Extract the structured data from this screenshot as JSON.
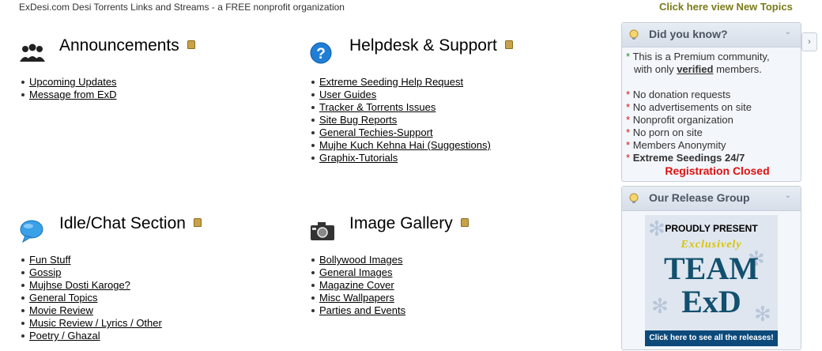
{
  "header": {
    "tagline": "ExDesi.com Desi Torrents Links and Streams - a FREE nonprofit organization",
    "new_topics": "Click here view New Topics"
  },
  "forums": [
    {
      "title": "Announcements",
      "icon": "users-icon",
      "links": [
        "Upcoming Updates",
        "Message from ExD"
      ]
    },
    {
      "title": "Helpdesk & Support",
      "icon": "help-icon",
      "links": [
        "Extreme Seeding Help Request",
        "User Guides",
        "Tracker & Torrents Issues",
        "Site Bug Reports",
        "General Techies-Support",
        "Mujhe Kuch Kehna Hai (Suggestions)",
        "Graphix-Tutorials"
      ]
    },
    {
      "title": "Idle/Chat Section",
      "icon": "chat-bubble-icon",
      "links": [
        "Fun Stuff",
        "Gossip",
        "Mujhse Dosti Karoge?",
        "General Topics",
        "Movie Review",
        "Music Review / Lyrics / Other",
        "Poetry / Ghazal"
      ]
    },
    {
      "title": "Image Gallery",
      "icon": "camera-icon",
      "links": [
        "Bollywood Images",
        "General Images",
        "Magazine Cover",
        "Misc Wallpapers",
        "Parties and Events"
      ]
    }
  ],
  "did_you_know": {
    "title": "Did you know?",
    "line1": "This is a Premium community,",
    "line2_pre": "with only",
    "line2_verified": "verified",
    "line2_post": "members.",
    "items": [
      "No donation requests",
      "No advertisements on site",
      "Nonprofit organization",
      "No porn on site",
      "Members Anonymity",
      "Extreme Seedings 24/7"
    ],
    "closed": "Registration Closed"
  },
  "release_group": {
    "title": "Our Release Group",
    "banner_line1": "PROUDLY PRESENT",
    "banner_line2": "Exclusively",
    "banner_line3": "TEAM",
    "banner_line4": "ExD",
    "banner_footer": "Click here to see all the releases!"
  },
  "colors": {
    "accent": "#7a7a1a",
    "closed": "#e01010",
    "sidebar_border": "#c7cfda"
  }
}
